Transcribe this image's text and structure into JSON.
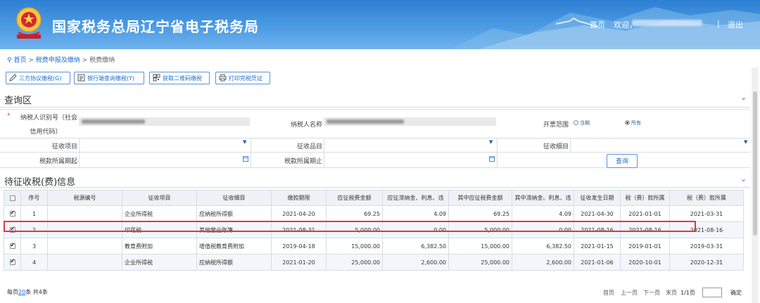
{
  "header": {
    "title": "国家税务总局辽宁省电子税务局",
    "home_link": "首页",
    "welcome": "欢迎，",
    "logout": "退出",
    "separator": "|"
  },
  "breadcrumb": [
    "首页",
    "税费申报及缴纳",
    "税费缴纳"
  ],
  "toolbar": [
    {
      "label": "三方协议缴税(G)",
      "icon": "pencil-icon"
    },
    {
      "label": "银行端查询缴税(Y)",
      "icon": "bank-icon"
    },
    {
      "label": "获取二维码缴税",
      "icon": "qrcode-icon"
    },
    {
      "label": "打印完税凭证",
      "icon": "print-icon"
    }
  ],
  "query": {
    "title": "查询区",
    "required_mark": "*",
    "taxpayer_id_label_line1": "纳税人识别号（社会",
    "taxpayer_id_label_line2": "信用代码）",
    "taxpayer_name_label": "纳税人名称",
    "invoice_range_label": "开票范围",
    "radio_current": "当期",
    "radio_all": "所有",
    "radio_selected": "所有",
    "levy_item_label": "征收项目",
    "levy_category_label": "征收品目",
    "levy_subitem_label": "征收细目",
    "period_start_label": "税款所属期起",
    "period_end_label": "税款所属期止",
    "query_button": "查询"
  },
  "table": {
    "title": "待征收税(费)信息",
    "columns": [
      "序号",
      "税源编号",
      "征收项目",
      "征收细目",
      "缴款期限",
      "应征税费金额",
      "应征滞纳金、利息、违",
      "其中应征税费金额",
      "其中滞纳金、利息、违",
      "征收发生日期",
      "税（费）款所属",
      "税（费）款所属"
    ],
    "rows": [
      {
        "checked": true,
        "no": "1",
        "source": "",
        "item": "企业所得税",
        "subitem": "应纳税所得额",
        "deadline": "2021-04-20",
        "amount": "69.25",
        "penalty": "4.09",
        "of_amount": "69.25",
        "of_penalty": "4.09",
        "occur": "2021-04-30",
        "from": "2021-01-01",
        "to": "2021-03-31"
      },
      {
        "checked": true,
        "no": "2",
        "source": "",
        "item": "印花税",
        "subitem": "其他营业账簿",
        "deadline": "2021-08-31",
        "amount": "5,000.00",
        "penalty": "0.00",
        "of_amount": "5,000.00",
        "of_penalty": "0.00",
        "occur": "2021-08-16",
        "from": "2021-08-16",
        "to": "2021-08-16"
      },
      {
        "checked": true,
        "no": "3",
        "source": "",
        "item": "教育费附加",
        "subitem": "增值税教育费附加",
        "deadline": "2019-04-18",
        "amount": "15,000.00",
        "penalty": "6,382.50",
        "of_amount": "15,000.00",
        "of_penalty": "6,382.50",
        "occur": "2021-01-15",
        "from": "2019-01-01",
        "to": "2019-03-31"
      },
      {
        "checked": true,
        "no": "4",
        "source": "",
        "item": "企业所得税",
        "subitem": "应纳税所得额",
        "deadline": "2021-01-20",
        "amount": "25,000.00",
        "penalty": "2,600.00",
        "of_amount": "25,000.00",
        "of_penalty": "2,600.00",
        "occur": "2021-01-06",
        "from": "2020-10-01",
        "to": "2020-12-31"
      }
    ],
    "highlighted_row": "2"
  },
  "pager": {
    "per_page_prefix": "每页",
    "per_page": "20",
    "per_page_suffix": "条 共4条",
    "first": "首页",
    "prev": "上一页",
    "next": "下一页",
    "last": "末页",
    "page_info": "1/1页",
    "confirm": "确定"
  },
  "colors": {
    "header": "#3b8de0",
    "link": "#1f6cc9",
    "highlight_border": "#e0393f"
  }
}
